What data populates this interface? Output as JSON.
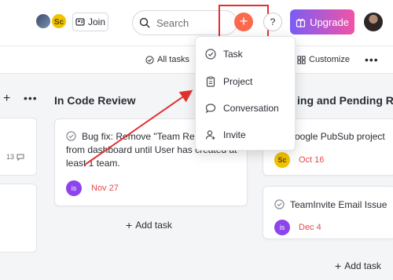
{
  "header": {
    "avatar_initials": "Sc",
    "join_label": "Join",
    "search_placeholder": "Search",
    "add_label": "+",
    "help_label": "?",
    "upgrade_label": "Upgrade"
  },
  "toolbar": {
    "all_tasks_label": "All tasks",
    "customize_label": "Customize",
    "more_label": "•••"
  },
  "left_column": {
    "add_label": "+",
    "more_label": "•••",
    "comment_count": "13"
  },
  "columns": [
    {
      "title": "In Code Review",
      "cards": [
        {
          "title_lines": [
            "Bug fix: Remove \"Team Repo",
            "from dashboard until User has created at",
            "least 1 team."
          ],
          "assignee_initials": "is",
          "due": "Nov 27"
        }
      ],
      "add_task_label": "Add task"
    },
    {
      "title": "ing and Pending Re",
      "cards": [
        {
          "title": "oogle PubSub project",
          "assignee_initials": "Sc",
          "due": "Oct 16"
        },
        {
          "title": "TeamInvite Email Issue",
          "assignee_initials": "is",
          "due": "Dec 4"
        }
      ],
      "add_task_label": "Add task"
    }
  ],
  "dropdown": {
    "items": [
      {
        "label": "Task",
        "icon": "check-circle-icon"
      },
      {
        "label": "Project",
        "icon": "clipboard-icon"
      },
      {
        "label": "Conversation",
        "icon": "chat-bubble-icon"
      },
      {
        "label": "Invite",
        "icon": "user-plus-icon"
      }
    ]
  },
  "colors": {
    "accent_orange": "#fc6a4e",
    "highlight_red": "#e03131",
    "assignee_purple": "#8e44ec",
    "assignee_yellow": "#f2c200",
    "due_red": "#e5484d"
  }
}
